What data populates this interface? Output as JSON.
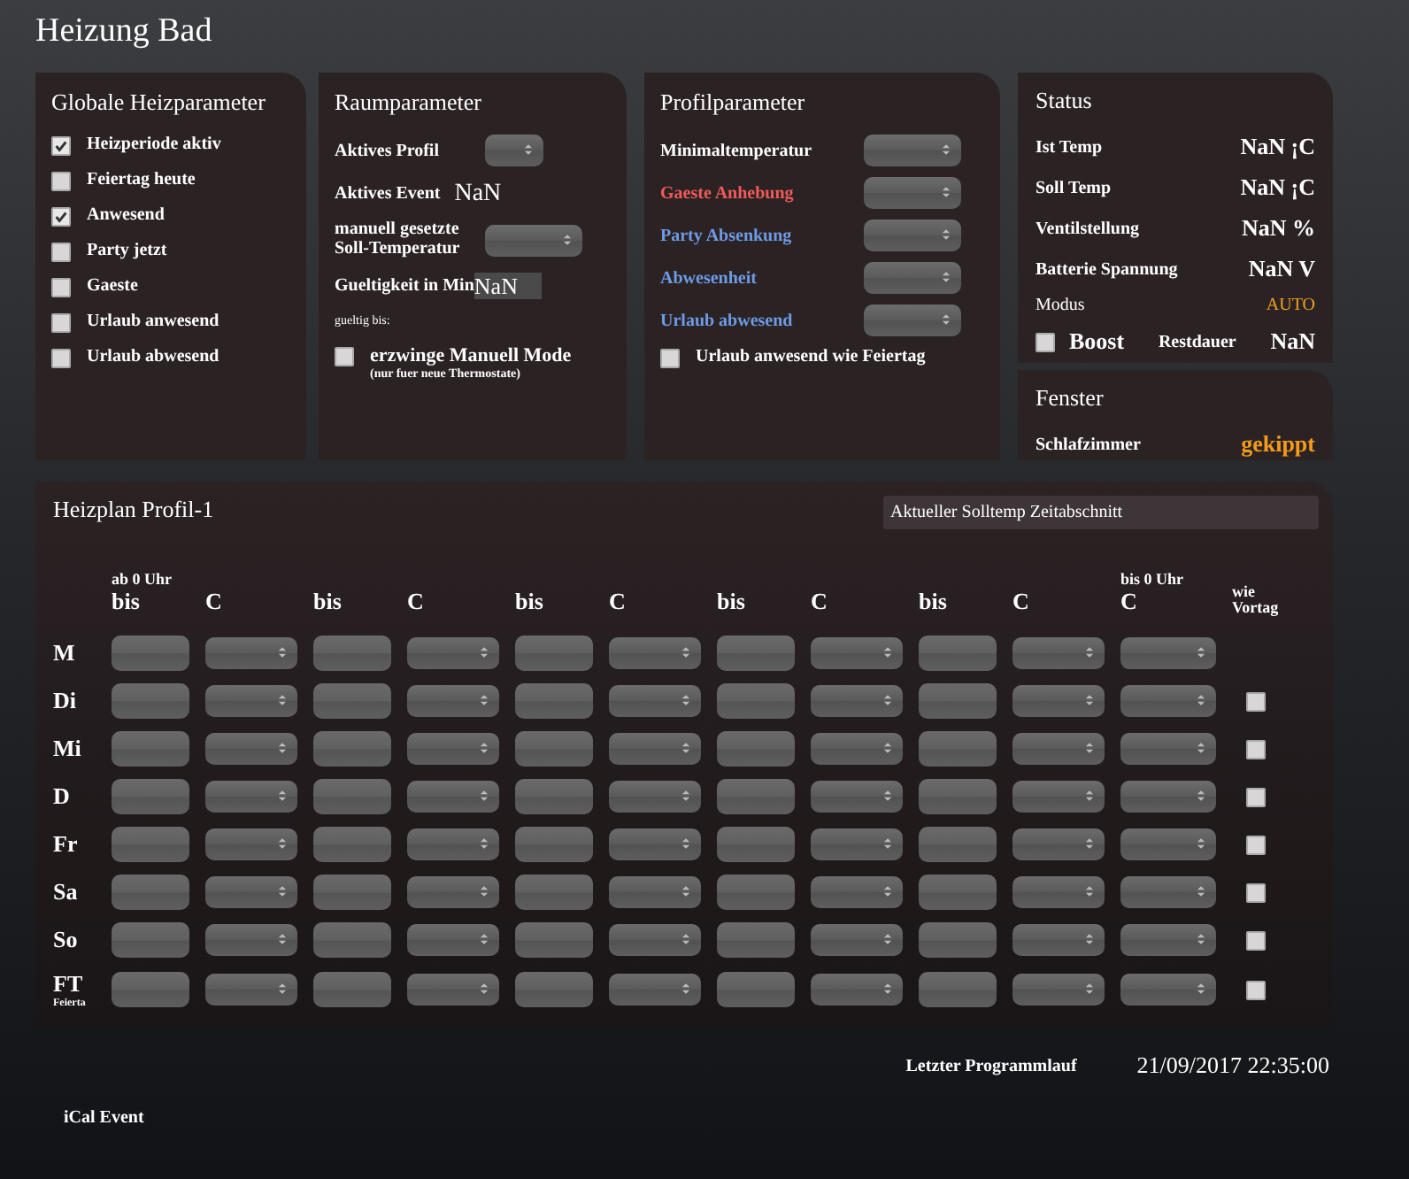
{
  "title": "Heizung Bad",
  "global": {
    "title": "Globale Heizparameter",
    "items": [
      {
        "label": "Heizperiode aktiv",
        "checked": true
      },
      {
        "label": "Feiertag heute",
        "checked": false
      },
      {
        "label": "Anwesend",
        "checked": true
      },
      {
        "label": "Party jetzt",
        "checked": false
      },
      {
        "label": "Gaeste",
        "checked": false
      },
      {
        "label": "Urlaub anwesend",
        "checked": false
      },
      {
        "label": "Urlaub abwesend",
        "checked": false
      }
    ]
  },
  "room": {
    "title": "Raumparameter",
    "active_profile_label": "Aktives Profil",
    "active_event_label": "Aktives Event",
    "active_event_value": "NaN",
    "manual_temp_label": "manuell gesetzte Soll-Temperatur",
    "validity_label": "Gueltigkeit in Min",
    "validity_value": "NaN",
    "valid_until_label": "gueltig bis:",
    "force_manual": {
      "label": "erzwinge Manuell Mode",
      "note": "(nur fuer neue Thermostate)",
      "checked": false
    }
  },
  "profile": {
    "title": "Profilparameter",
    "rows": [
      {
        "label": "Minimaltemperatur",
        "color": "#ffffff"
      },
      {
        "label": "Gaeste Anhebung",
        "color": "#f05a5a"
      },
      {
        "label": "Party Absenkung",
        "color": "#6e9be6"
      },
      {
        "label": "Abwesenheit",
        "color": "#6e9be6"
      },
      {
        "label": "Urlaub abwesend",
        "color": "#6e9be6"
      }
    ],
    "holiday_option": {
      "label": "Urlaub anwesend wie Feiertag",
      "checked": false
    }
  },
  "status": {
    "title": "Status",
    "rows": [
      {
        "label": "Ist Temp",
        "value": "NaN ¡C"
      },
      {
        "label": "Soll Temp",
        "value": "NaN ¡C"
      },
      {
        "label": "Ventilstellung",
        "value": "NaN %"
      },
      {
        "label": "Batterie Spannung",
        "value": "NaN V"
      }
    ],
    "mode_label": "Modus",
    "mode_value": "AUTO",
    "boost": {
      "label": "Boost",
      "checked": false
    },
    "remaining_label": "Restdauer",
    "remaining_value": "NaN"
  },
  "window_panel": {
    "title": "Fenster",
    "room": "Schlafzimmer",
    "state": "gekippt"
  },
  "schedule": {
    "title": "Heizplan Profil-1",
    "current_segment": "Aktueller Solltemp Zeitabschnitt",
    "start_note": "ab 0 Uhr",
    "end_note": "bis 0 Uhr",
    "segments": [
      {
        "until": "bis",
        "temp": "C"
      },
      {
        "until": "bis",
        "temp": "C"
      },
      {
        "until": "bis",
        "temp": "C"
      },
      {
        "until": "bis",
        "temp": "C"
      },
      {
        "until": "bis",
        "temp": "C"
      }
    ],
    "final_temp": "C",
    "same_as_prev": "wie Vortag",
    "days": [
      {
        "label": "M"
      },
      {
        "label": "Di",
        "copy_previous": false
      },
      {
        "label": "Mi",
        "copy_previous": false
      },
      {
        "label": "D",
        "copy_previous": false
      },
      {
        "label": "Fr",
        "copy_previous": false
      },
      {
        "label": "Sa",
        "copy_previous": false
      },
      {
        "label": "So",
        "copy_previous": false
      },
      {
        "label": "FT",
        "note": "Feierta",
        "copy_previous": false
      }
    ]
  },
  "last_run_label": "Letzter Programmlauf",
  "last_run_value": "21/09/2017 22:35:00",
  "ical_label": "iCal Event"
}
